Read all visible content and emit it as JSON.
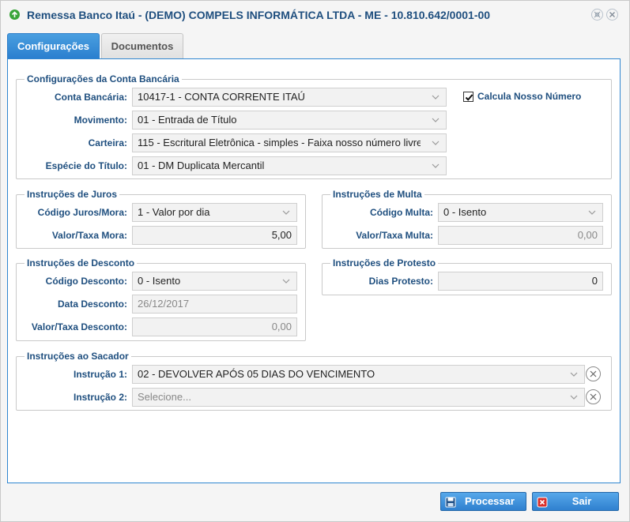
{
  "window": {
    "title": "Remessa Banco Itaú - (DEMO) COMPELS INFORMÁTICA LTDA - ME - 10.810.642/0001-00"
  },
  "tabs": [
    {
      "label": "Configurações"
    },
    {
      "label": "Documentos"
    }
  ],
  "conta": {
    "legend": "Configurações da Conta Bancária",
    "conta_label": "Conta Bancária:",
    "conta_value": "10417-1 - CONTA CORRENTE ITAÚ",
    "movimento_label": "Movimento:",
    "movimento_value": "01 - Entrada de Título",
    "carteira_label": "Carteira:",
    "carteira_value": "115 - Escritural Eletrônica - simples - Faixa nosso número livre,",
    "especie_label": "Espécie do Título:",
    "especie_value": "01 - DM Duplicata Mercantil",
    "calcula_label": "Calcula Nosso Número",
    "calcula_checked": true
  },
  "juros": {
    "legend": "Instruções de Juros",
    "codigo_label": "Código Juros/Mora:",
    "codigo_value": "1 - Valor por dia",
    "valor_label": "Valor/Taxa Mora:",
    "valor_value": "5,00"
  },
  "multa": {
    "legend": "Instruções de Multa",
    "codigo_label": "Código Multa:",
    "codigo_value": "0 - Isento",
    "valor_label": "Valor/Taxa Multa:",
    "valor_value": "0,00"
  },
  "desconto": {
    "legend": "Instruções de Desconto",
    "codigo_label": "Código Desconto:",
    "codigo_value": "0 - Isento",
    "data_label": "Data Desconto:",
    "data_value": "26/12/2017",
    "valor_label": "Valor/Taxa Desconto:",
    "valor_value": "0,00"
  },
  "protesto": {
    "legend": "Instruções de Protesto",
    "dias_label": "Dias Protesto:",
    "dias_value": "0"
  },
  "sacador": {
    "legend": "Instruções ao Sacador",
    "instrucao1_label": "Instrução 1:",
    "instrucao1_value": "02 - DEVOLVER APÓS 05 DIAS DO VENCIMENTO",
    "instrucao2_label": "Instrução 2:",
    "instrucao2_placeholder": "Selecione..."
  },
  "buttons": {
    "processar": "Processar",
    "sair": "Sair"
  },
  "colors": {
    "accent": "#2b7fcf",
    "label": "#1f4f7f",
    "title_icon": "#3aa53a",
    "sair_icon": "#d9302c"
  },
  "icons": {
    "title": "green-circle-icon",
    "processar": "save-icon",
    "sair": "exit-icon"
  }
}
